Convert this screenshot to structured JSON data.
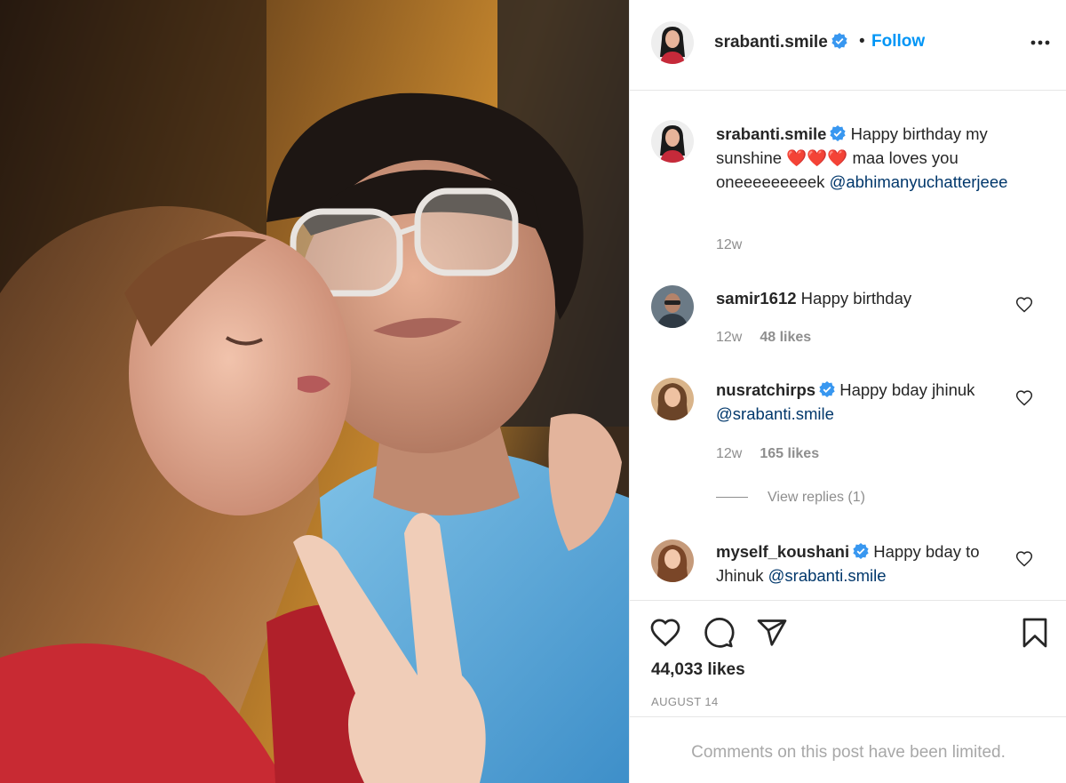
{
  "post": {
    "username": "srabanti.smile",
    "follow_label": "Follow",
    "separator": "•",
    "likes_count": "44,033 likes",
    "date": "AUGUST 14",
    "comments_limited": "Comments on this post have been limited."
  },
  "caption": {
    "username": "srabanti.smile",
    "text": "Happy birthday my sunshine",
    "emoji": "❤️❤️❤️",
    "text2": "maa loves you oneeeeeeeeek",
    "mention": "@abhimanyuchatterjeee",
    "time": "12w"
  },
  "comments": [
    {
      "username": "samir1612",
      "text": "Happy birthday",
      "time": "12w",
      "likes": "48 likes"
    },
    {
      "username": "nusratchirps",
      "text": "Happy bday jhinuk",
      "mention": "@srabanti.smile",
      "time": "12w",
      "likes": "165 likes",
      "view_replies": "View replies (1)"
    },
    {
      "username": "myself_koushani",
      "text": "Happy bday to Jhinuk",
      "mention": "@srabanti.smile"
    }
  ],
  "icons": {
    "verified": "verified-badge-icon",
    "more": "more-options-icon",
    "like": "heart-icon",
    "comment": "comment-icon",
    "share": "send-icon",
    "save": "bookmark-icon"
  },
  "colors": {
    "link": "#0095f6",
    "mention": "#00376b",
    "muted": "#8e8e8e",
    "text": "#262626",
    "verified": "#3897f0"
  }
}
